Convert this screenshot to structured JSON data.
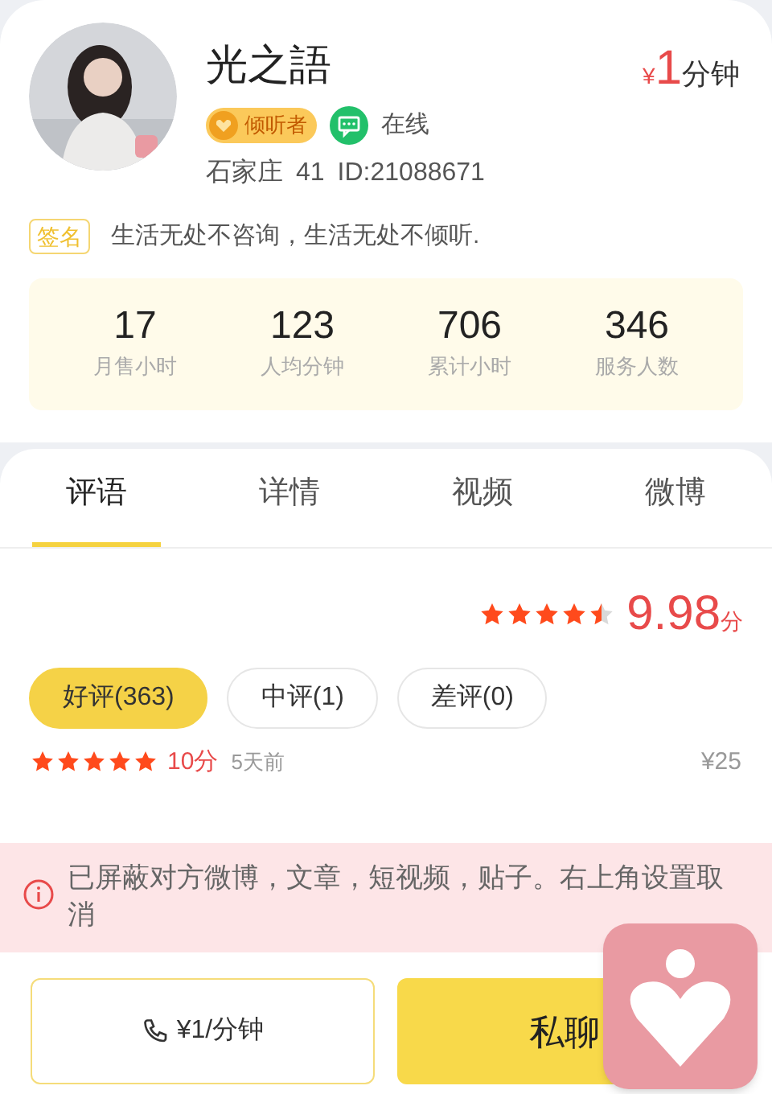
{
  "profile": {
    "name": "光之語",
    "badge": "倾听者",
    "status": "在线",
    "online": true,
    "location": "石家庄",
    "age": "41",
    "id": "ID:21088671",
    "price": {
      "currency": "¥",
      "amount": "1",
      "unit": "分钟"
    }
  },
  "signature": {
    "label": "签名",
    "text": "生活无处不咨询，生活无处不倾听."
  },
  "stats": [
    {
      "value": "17",
      "label": "月售小时"
    },
    {
      "value": "123",
      "label": "人均分钟"
    },
    {
      "value": "706",
      "label": "累计小时"
    },
    {
      "value": "346",
      "label": "服务人数"
    }
  ],
  "tabs": [
    {
      "label": "评语",
      "selected": true
    },
    {
      "label": "详情",
      "selected": false
    },
    {
      "label": "视频",
      "selected": false
    },
    {
      "label": "微博",
      "selected": false
    }
  ],
  "rating": {
    "stars": 4.5,
    "score": "9.98",
    "unit": "分"
  },
  "filters": [
    {
      "label": "好评(363)",
      "selected": true
    },
    {
      "label": "中评(1)",
      "selected": false
    },
    {
      "label": "差评(0)",
      "selected": false
    }
  ],
  "review": {
    "stars": 5,
    "score": "10分",
    "time": "5天前",
    "price": "¥25"
  },
  "notice": "已屏蔽对方微博，文章，短视频，贴子。右上角设置取消",
  "buttons": {
    "call": "¥1/分钟",
    "chat": "私聊"
  }
}
